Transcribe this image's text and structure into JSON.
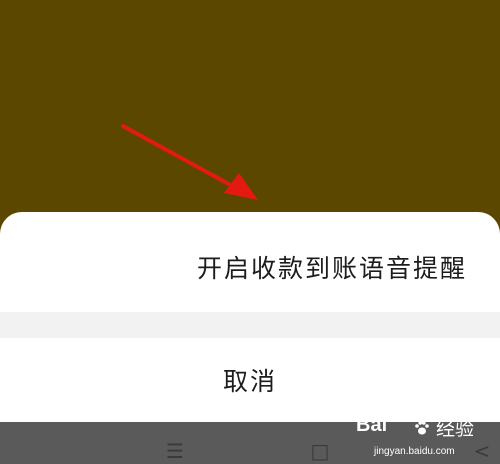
{
  "sheet": {
    "action_label": "开启收款到账语音提醒",
    "cancel_label": "取消"
  },
  "navbar": {
    "menu_glyph": "☰",
    "home_glyph": "□",
    "back_glyph": "<"
  },
  "watermark": {
    "logo_text": "Bai",
    "title_text": "经验",
    "url_text": "jingyan.baidu.com"
  },
  "colors": {
    "backdrop": "#5c4700",
    "sheet": "#ffffff",
    "gap": "#f2f2f2",
    "navbar": "#5a5a5a",
    "arrow": "#e41a12"
  },
  "icons": [
    "arrow-annotation",
    "menu-icon",
    "home-icon",
    "back-icon",
    "paw-icon"
  ]
}
